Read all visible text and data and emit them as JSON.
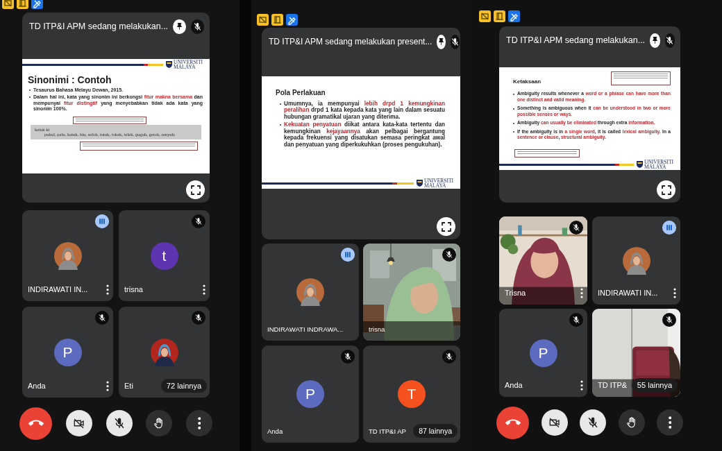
{
  "panels": [
    {
      "tool_icons": [
        {
          "kind": "slides"
        },
        {
          "kind": "door"
        },
        {
          "kind": "pen"
        }
      ],
      "presentation": {
        "title": "TD ITP&I APM sedang melakukan...",
        "pin": true,
        "muted": true,
        "slide": {
          "kind": "scan-example",
          "banner_at_top": true,
          "logo": "UNIVERSITI MALAYA",
          "title": "Sinonimi : Contoh",
          "bullets": [
            [
              {
                "text": "Tesaurus Bahasa Melayu Dewan, 2015.",
                "red": false
              }
            ],
            [
              {
                "text": "Dalam hal ini, kata yang sinonim ini berkongsi ",
                "red": false
              },
              {
                "text": "fitur makna bersama",
                "red": true
              },
              {
                "text": " dan mempunyai ",
                "red": false
              },
              {
                "text": "fitur distingtif",
                "red": true
              },
              {
                "text": " yang menyebabkan tidak ada kata yang sinonim 100%.",
                "red": false
              }
            ]
          ],
          "scan": {
            "headword": "ketuk kt",
            "synonyms": "pukul, palu, katuk, hiu, seloh, tutuk, tokek, telek, guguh, getok, renyuh;"
          }
        }
      },
      "tiles": [
        {
          "name": "INDIRAWATI IN...",
          "speaking": true,
          "muted": false,
          "menu": true
        },
        {
          "name": "trisna",
          "avatar": {
            "kind": "letter",
            "letter": "t",
            "color": "#5e35b1"
          },
          "speaking": false,
          "muted": true,
          "menu": true
        },
        {
          "name": "Anda",
          "avatar": {
            "kind": "letter",
            "letter": "P",
            "color": "#5c6bc0"
          },
          "speaking": false,
          "muted": true,
          "menu": true
        },
        {
          "name": "Eti",
          "speaking": false,
          "muted": true,
          "menu": false,
          "others": "72 lainnya"
        }
      ],
      "controls": [
        {
          "kind": "hangup"
        },
        {
          "kind": "camera-off"
        },
        {
          "kind": "mic-off"
        },
        {
          "kind": "raise-hand"
        },
        {
          "kind": "more"
        }
      ]
    },
    {
      "tool_icons": [
        {
          "kind": "slides"
        },
        {
          "kind": "door"
        },
        {
          "kind": "pen"
        }
      ],
      "presentation": {
        "title": "TD ITP&I APM sedang melakukan present...",
        "pin": true,
        "muted": true,
        "slide": {
          "kind": "text",
          "banner_at_top": false,
          "logo": "UNIVERSITI MALAYA",
          "title": "Pola Perlakuan",
          "bullets": [
            [
              {
                "text": "Umumnya, ia mempunyai ",
                "red": false
              },
              {
                "text": "lebih drpd 1 kemungkinan peralihan",
                "red": true
              },
              {
                "text": " drpd 1 kata kepada kata yang lain dalam sesuatu hubungan gramatikal ujaran yang diterima.",
                "red": false
              }
            ],
            [
              {
                "text": "Kekuatan penyatuan",
                "red": true
              },
              {
                "text": " diikat antara kata-kata tertentu dan kemungkinan ",
                "red": false
              },
              {
                "text": "kejayaannya",
                "red": true
              },
              {
                "text": " akan pelbagai bergantung kepada frekuensi yang disatukan semasa peringkat awal dan penyatuan yang diperkukuhkan (proses pengukuhan).",
                "red": false
              }
            ]
          ]
        }
      },
      "tiles": [
        {
          "name": "INDIRAWATI  INDRAWA...",
          "speaking": true,
          "muted": false,
          "menu": false
        },
        {
          "name": "trisna",
          "avatar": {
            "kind": "video"
          },
          "speaking": false,
          "muted": true,
          "menu": false
        },
        {
          "name": "Anda",
          "avatar": {
            "kind": "letter",
            "letter": "P",
            "color": "#5c6bc0"
          },
          "speaking": false,
          "muted": true,
          "menu": false
        },
        {
          "name": "TD ITP&I AP",
          "avatar": {
            "kind": "letter",
            "letter": "T",
            "color": "#f4511e"
          },
          "speaking": false,
          "muted": true,
          "menu": false,
          "others": "87 lainnya"
        }
      ]
    },
    {
      "tool_icons": [
        {
          "kind": "slides"
        },
        {
          "kind": "door"
        },
        {
          "kind": "pen"
        }
      ],
      "presentation": {
        "title": "TD ITP&I APM sedang melakukan...",
        "pin": true,
        "muted": true,
        "slide": {
          "kind": "annotated",
          "banner_at_top": false,
          "logo": "UNIVERSITI MALAYA",
          "title": "Ketaksaan",
          "bullets": [
            [
              {
                "text": "Ambiguity results whenever a ",
                "red": false
              },
              {
                "text": "word or a phrase can have more than one distinct and valid meaning.",
                "red": true
              }
            ],
            [
              {
                "text": "Something is ambiguous when it ",
                "red": false
              },
              {
                "text": "can be understood in two or more possible senses or ways.",
                "red": true
              }
            ],
            [
              {
                "text": "Ambiguity ",
                "red": false
              },
              {
                "text": "can usually be eliminated",
                "red": true
              },
              {
                "text": " through extra ",
                "red": false
              },
              {
                "text": "information.",
                "red": true
              }
            ],
            [
              {
                "text": "If the ambiguity is in ",
                "red": false
              },
              {
                "text": "a single word",
                "red": true
              },
              {
                "text": ", it is called ",
                "red": false
              },
              {
                "text": "lexical ambiguity",
                "red": true
              },
              {
                "text": ". In a ",
                "red": false
              },
              {
                "text": "sentence or clause",
                "red": true
              },
              {
                "text": ", ",
                "red": false
              },
              {
                "text": "structural ambiguity",
                "red": true
              },
              {
                "text": ".",
                "red": false
              }
            ]
          ]
        }
      },
      "tiles": [
        {
          "name": "Trisna",
          "avatar": {
            "kind": "video"
          },
          "speaking": false,
          "muted": true,
          "menu": true
        },
        {
          "name": "INDIRAWATI  IN...",
          "speaking": true,
          "muted": false,
          "menu": true
        },
        {
          "name": "Anda",
          "avatar": {
            "kind": "letter",
            "letter": "P",
            "color": "#5c6bc0"
          },
          "speaking": false,
          "muted": true,
          "menu": true
        },
        {
          "name": "TD ITP&",
          "avatar": {
            "kind": "video"
          },
          "speaking": false,
          "muted": true,
          "menu": false,
          "others": "55 lainnya"
        }
      ],
      "controls": [
        {
          "kind": "hangup"
        },
        {
          "kind": "camera-off"
        },
        {
          "kind": "mic-off"
        },
        {
          "kind": "raise-hand"
        },
        {
          "kind": "more"
        }
      ]
    }
  ]
}
